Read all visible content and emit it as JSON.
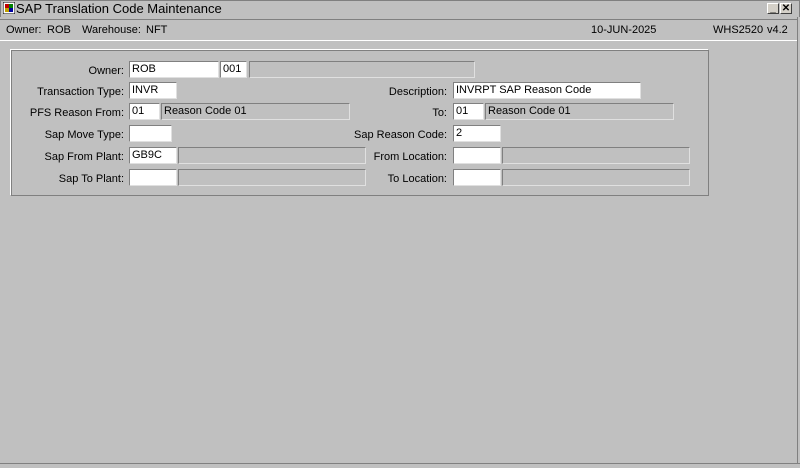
{
  "window": {
    "title": "SAP Translation Code Maintenance",
    "icon": "app-icon",
    "minimize_label": "_",
    "close_label": "✕"
  },
  "status": {
    "owner_label": "Owner:",
    "owner_value": "ROB",
    "warehouse_label": "Warehouse:",
    "warehouse_value": "NFT",
    "date": "10-JUN-2025",
    "module": "WHS2520",
    "version": "v4.2"
  },
  "form": {
    "owner": {
      "label": "Owner:",
      "value": "ROB",
      "code": "001",
      "desc": ""
    },
    "transaction_type": {
      "label": "Transaction Type:",
      "value": "INVR"
    },
    "description": {
      "label": "Description:",
      "value": "INVRPT SAP Reason Code"
    },
    "pfs_reason_from": {
      "label": "PFS Reason From:",
      "value": "01",
      "desc": "Reason Code 01"
    },
    "to": {
      "label": "To:",
      "value": "01",
      "desc": "Reason Code 01"
    },
    "sap_move_type": {
      "label": "Sap Move Type:",
      "value": ""
    },
    "sap_reason_code": {
      "label": "Sap Reason Code:",
      "value": "2"
    },
    "sap_from_plant": {
      "label": "Sap From Plant:",
      "value": "GB9C",
      "desc": ""
    },
    "from_location": {
      "label": "From Location:",
      "value": "",
      "desc": ""
    },
    "sap_to_plant": {
      "label": "Sap To Plant:",
      "value": "",
      "desc": ""
    },
    "to_location": {
      "label": "To Location:",
      "value": "",
      "desc": ""
    }
  }
}
